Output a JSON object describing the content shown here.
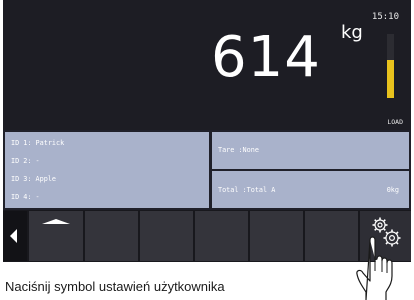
{
  "status": {
    "clock": "15:10"
  },
  "display": {
    "weight": "614",
    "unit": "kg",
    "load_label": "LOAD",
    "load_level_percent": 60
  },
  "ids": [
    {
      "label": "ID 1: Patrick"
    },
    {
      "label": "ID 2: -"
    },
    {
      "label": "ID 3: Apple"
    },
    {
      "label": "ID 4: -"
    }
  ],
  "tare": {
    "label": "Tare  :None"
  },
  "total": {
    "label": "Total :Total A",
    "value": "0kg"
  },
  "softkeys": [
    {
      "icon": "chevron-left-icon"
    },
    {
      "icon": "arrow-up-icon"
    },
    {
      "icon": ""
    },
    {
      "icon": ""
    },
    {
      "icon": ""
    },
    {
      "icon": ""
    },
    {
      "icon": ""
    },
    {
      "icon": "settings-gears-icon"
    }
  ],
  "caption": "Naciśnij symbol ustawień użytkownika",
  "colors": {
    "load_bar": "#e8c21d",
    "info_panel": "#a9b2cb",
    "screen_background": "#1d1d24"
  }
}
